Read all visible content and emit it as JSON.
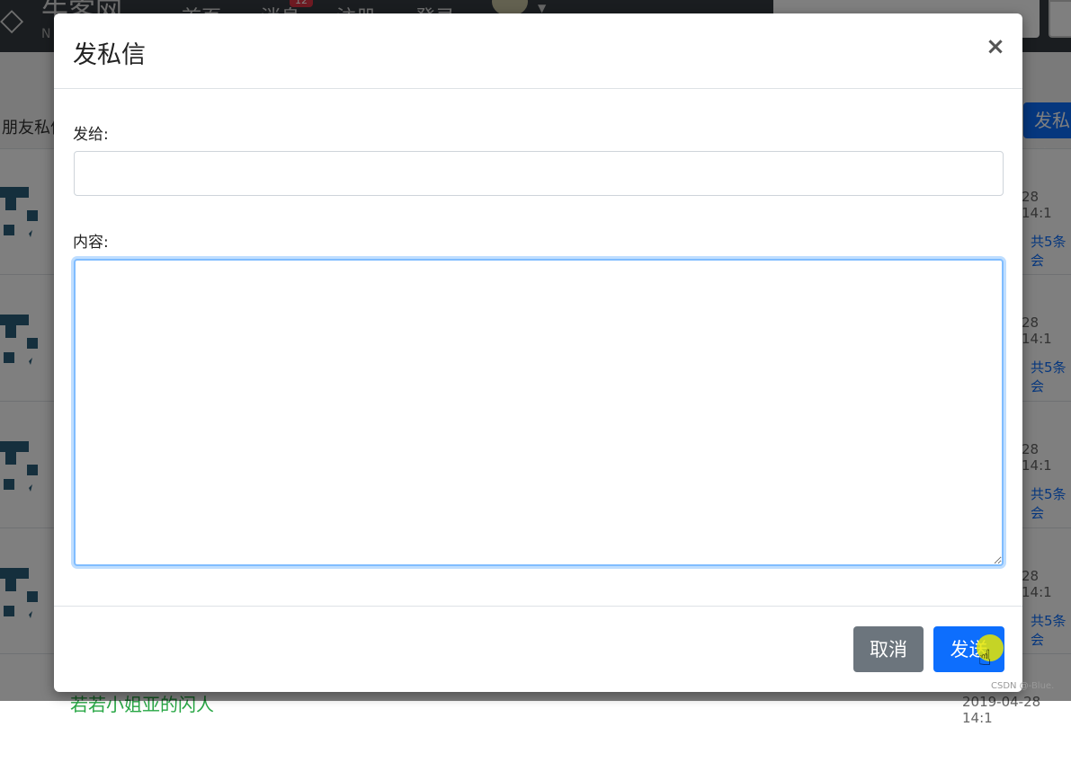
{
  "background": {
    "logo_text": "牛客网",
    "logo_sub": "N",
    "nav": [
      "首页",
      "消息",
      "注册",
      "登录"
    ],
    "message_badge": "12",
    "friends_label": "朋友私信",
    "send_button_label": "发私信",
    "rows": [
      {
        "time": "28 14:1",
        "count": "共5条会"
      },
      {
        "time": "28 14:1",
        "count": "共5条会"
      },
      {
        "time": "28 14:1",
        "count": "共5条会"
      },
      {
        "time": "28 14:1",
        "count": "共5条会"
      }
    ],
    "bottom_title": "若若小姐亚的闪人",
    "bottom_time": "2019-04-28 14:1"
  },
  "modal": {
    "title": "发私信",
    "close_symbol": "×",
    "to_label": "发给:",
    "to_value": "",
    "content_label": "内容:",
    "content_value": "",
    "cancel_label": "取消",
    "send_label": "发送"
  },
  "watermark": "CSDN @-Blue.",
  "colors": {
    "primary": "#0d6efd",
    "secondary": "#6c757d",
    "focus_border": "#80bdff",
    "topbar": "#343a40"
  }
}
